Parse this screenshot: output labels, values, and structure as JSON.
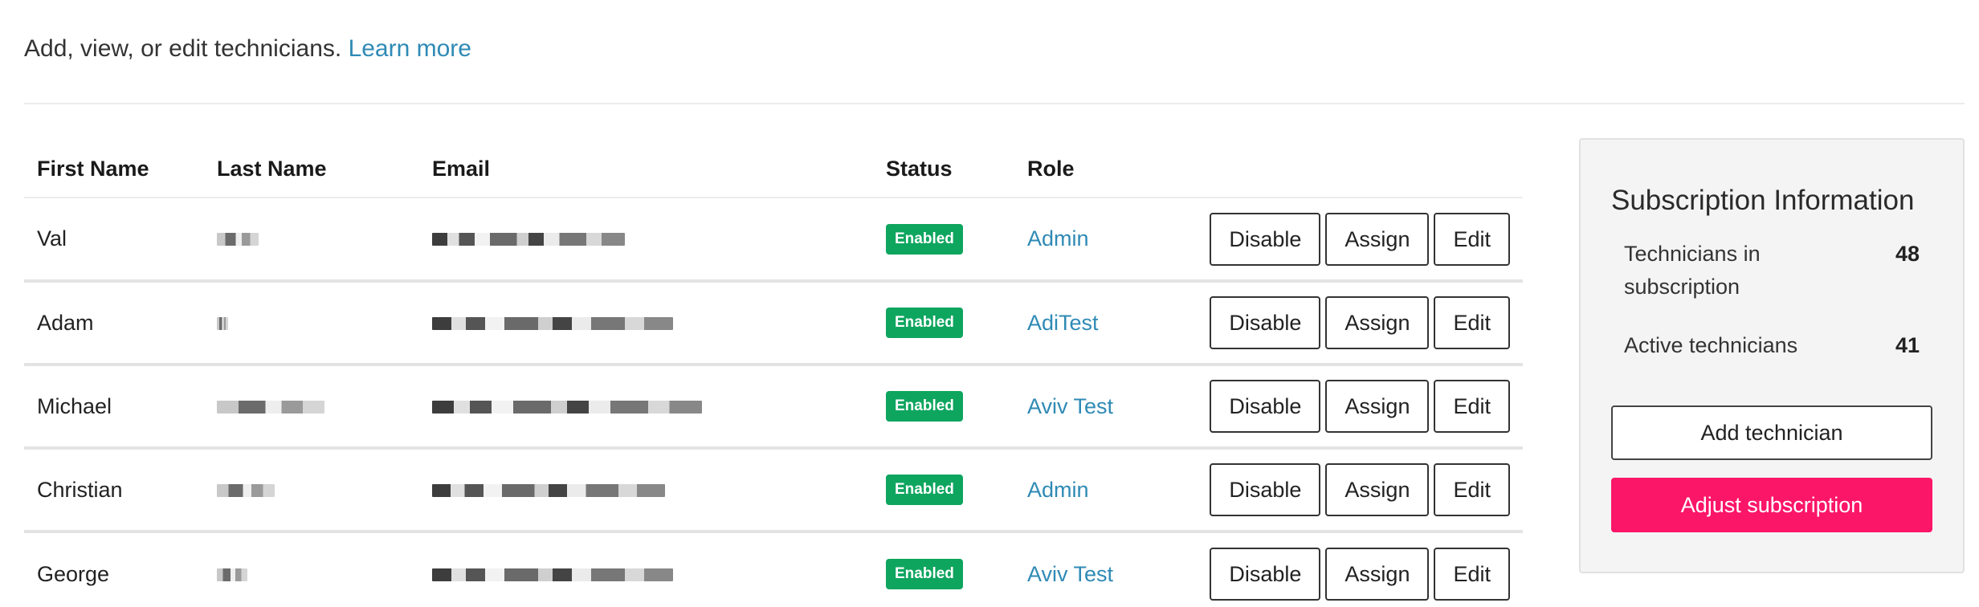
{
  "intro": {
    "text": "Add, view, or edit technicians.",
    "link": "Learn more"
  },
  "table": {
    "headers": {
      "first_name": "First Name",
      "last_name": "Last Name",
      "email": "Email",
      "status": "Status",
      "role": "Role"
    },
    "rows": [
      {
        "first_name": "Val",
        "status": "Enabled",
        "role": "Admin"
      },
      {
        "first_name": "Adam",
        "status": "Enabled",
        "role": "AdiTest"
      },
      {
        "first_name": "Michael",
        "status": "Enabled",
        "role": "Aviv Test"
      },
      {
        "first_name": "Christian",
        "status": "Enabled",
        "role": "Admin"
      },
      {
        "first_name": "George",
        "status": "Enabled",
        "role": "Aviv Test"
      }
    ],
    "actions": {
      "disable": "Disable",
      "assign": "Assign",
      "edit": "Edit"
    }
  },
  "subscription": {
    "title": "Subscription Information",
    "technicians_label": "Technicians in subscription",
    "technicians_value": "48",
    "active_label": "Active technicians",
    "active_value": "41",
    "add_button": "Add technician",
    "adjust_button": "Adjust subscription"
  },
  "colors": {
    "link": "#2f8ab5",
    "enabled_badge": "#0ea55f",
    "primary_button": "#fc1668"
  }
}
